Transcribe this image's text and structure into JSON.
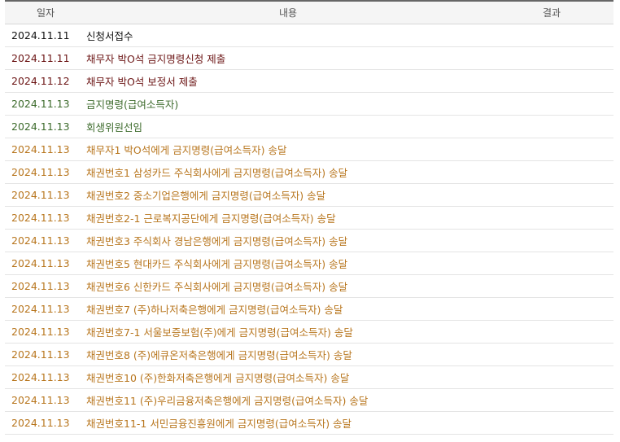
{
  "table": {
    "headers": {
      "date": "일자",
      "content": "내용",
      "result": "결과"
    },
    "rows": [
      {
        "date": "2024.11.11",
        "content": "신청서접수",
        "result": "",
        "color": "#111111"
      },
      {
        "date": "2024.11.11",
        "content": "채무자 박O석 금지명령신청 제출",
        "result": "",
        "color": "#6b1414"
      },
      {
        "date": "2024.11.12",
        "content": "채무자 박O석 보정서 제출",
        "result": "",
        "color": "#6b1414"
      },
      {
        "date": "2024.11.13",
        "content": "금지명령(급여소득자)",
        "result": "",
        "color": "#3d6b2c"
      },
      {
        "date": "2024.11.13",
        "content": "회생위원선임",
        "result": "",
        "color": "#3d6b2c"
      },
      {
        "date": "2024.11.13",
        "content": "채무자1 박O석에게 금지명령(급여소득자) 송달",
        "result": "",
        "color": "#b8761e"
      },
      {
        "date": "2024.11.13",
        "content": "채권번호1 삼성카드 주식회사에게 금지명령(급여소득자) 송달",
        "result": "",
        "color": "#b8761e"
      },
      {
        "date": "2024.11.13",
        "content": "채권번호2 중소기업은행에게 금지명령(급여소득자) 송달",
        "result": "",
        "color": "#b8761e"
      },
      {
        "date": "2024.11.13",
        "content": "채권번호2-1 근로복지공단에게 금지명령(급여소득자) 송달",
        "result": "",
        "color": "#b8761e"
      },
      {
        "date": "2024.11.13",
        "content": "채권번호3 주식회사 경남은행에게 금지명령(급여소득자) 송달",
        "result": "",
        "color": "#b8761e"
      },
      {
        "date": "2024.11.13",
        "content": "채권번호5 현대카드 주식회사에게 금지명령(급여소득자) 송달",
        "result": "",
        "color": "#b8761e"
      },
      {
        "date": "2024.11.13",
        "content": "채권번호6 신한카드 주식회사에게 금지명령(급여소득자) 송달",
        "result": "",
        "color": "#b8761e"
      },
      {
        "date": "2024.11.13",
        "content": "채권번호7 (주)하나저축은행에게 금지명령(급여소득자) 송달",
        "result": "",
        "color": "#b8761e"
      },
      {
        "date": "2024.11.13",
        "content": "채권번호7-1 서울보증보험(주)에게 금지명령(급여소득자) 송달",
        "result": "",
        "color": "#b8761e"
      },
      {
        "date": "2024.11.13",
        "content": "채권번호8 (주)에큐온저축은행에게 금지명령(급여소득자) 송달",
        "result": "",
        "color": "#b8761e"
      },
      {
        "date": "2024.11.13",
        "content": "채권번호10 (주)한화저축은행에게 금지명령(급여소득자) 송달",
        "result": "",
        "color": "#b8761e"
      },
      {
        "date": "2024.11.13",
        "content": "채권번호11 (주)우리금융저축은행에게 금지명령(급여소득자) 송달",
        "result": "",
        "color": "#b8761e"
      },
      {
        "date": "2024.11.13",
        "content": "채권번호11-1 서민금융진흥원에게 금지명령(급여소득자) 송달",
        "result": "",
        "color": "#b8761e"
      }
    ]
  }
}
